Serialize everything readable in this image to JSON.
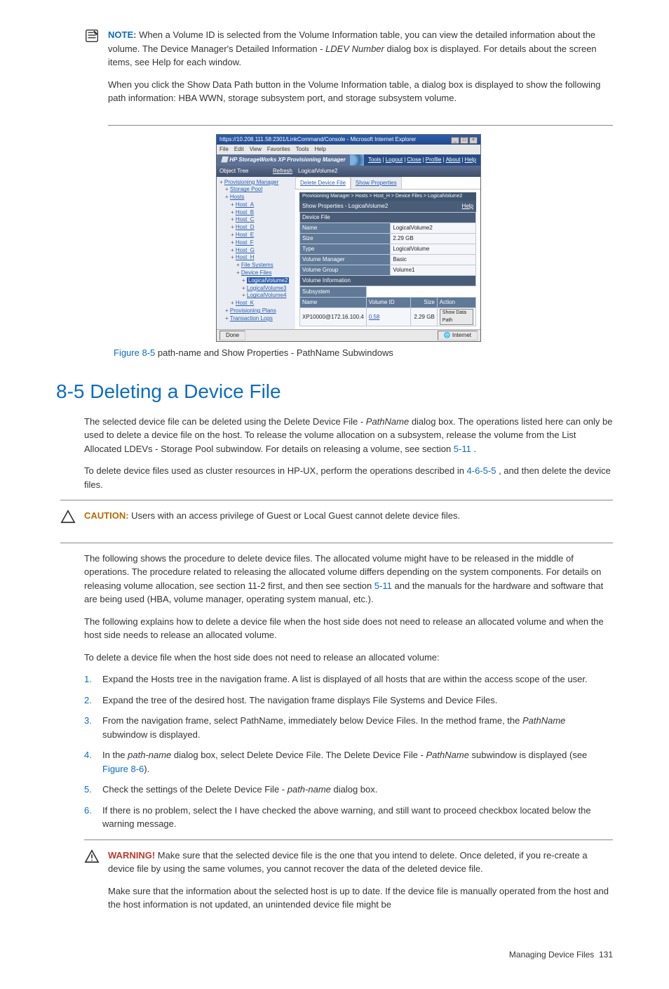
{
  "note": {
    "label": "NOTE:",
    "para1a": "When a Volume ID is selected from the Volume Information table, you can view the detailed information about the volume. The Device Manager's Detailed Information - ",
    "para1_italic": "LDEV Number",
    "para1b": " dialog box is displayed. For details about the screen items, see Help for each window.",
    "para2": "When you click the Show Data Path button in the Volume Information table, a dialog box is displayed to show the following path information: HBA WWN, storage subsystem port, and storage subsystem volume."
  },
  "figure": {
    "caption_link": "Figure 8-5",
    "caption_text": " path-name and Show Properties - PathName Subwindows",
    "shot": {
      "browser_title": "https://10.208.111.58:2301/LinkCommand/Console - Microsoft Internet Explorer",
      "menus": [
        "File",
        "Edit",
        "View",
        "Favorites",
        "Tools",
        "Help"
      ],
      "brand_box": "⬜",
      "brand": "HP StorageWorks XP Provisioning Manager",
      "brand_links": [
        "Tools",
        "Logout",
        "Close",
        "Profile",
        "About",
        "Help"
      ],
      "left_header": "Object Tree",
      "refresh": "Refresh",
      "tree": {
        "pm": "Provisioning Manager",
        "sp": "Storage Pool",
        "hosts": "Hosts",
        "hostA": "Host_A",
        "hostB": "Host_B",
        "hostC": "Host_C",
        "hostD": "Host_D",
        "hostE": "Host_E",
        "hostF": "Host_F",
        "hostG": "Host_G",
        "hostH": "Host_H",
        "fs": "File Systems",
        "df": "Device Files",
        "lv2": "LogicalVolume2",
        "lv3": "LogicalVolume3",
        "lv4": "LogicalVolume4",
        "hostK": "Host_K",
        "pp": "Provisioning Plans",
        "tl": "Transaction Logs"
      },
      "right_header": "LogicalVolume2",
      "method_nav": [
        "Delete Device File",
        "Show Properties"
      ],
      "crumb": "Provisioning Manager > Hosts > Host_H > Device Files > LogicalVolume2",
      "subhead": "Show Properties - LogicalVolume2",
      "help": "Help",
      "sections": {
        "device_file": "Device File",
        "vol_info": "Volume Information"
      },
      "rows": {
        "name_k": "Name",
        "name_v": "LogicalVolume2",
        "size_k": "Size",
        "size_v": "2.29 GB",
        "type_k": "Type",
        "type_v": "LogicalVolume",
        "vm_k": "Volume Manager",
        "vm_v": "Basic",
        "vg_k": "Volume Group",
        "vg_v": "Volume1"
      },
      "vol_cols": {
        "sub": "Subsystem",
        "name": "Name",
        "vid": "Volume ID",
        "size": "Size",
        "action": "Action"
      },
      "vol_row": {
        "sub": "XP10000@172.16.100.4",
        "vid": "0.58",
        "size": "2.29 GB",
        "btn": "Show Data Path"
      },
      "status_done": "Done",
      "status_net": "Internet"
    }
  },
  "section": {
    "title": "8-5 Deleting a Device File",
    "p1a": "The selected device file can be deleted using the Delete Device File - ",
    "p1_i": "PathName",
    "p1b": " dialog box. The operations listed here can only be used to delete a device file on the host. To release the volume allocation on a subsystem, release the volume from the List Allocated LDEVs - Storage Pool subwindow. For details on releasing a volume, see section ",
    "p1_link": "5-11",
    "p1c": " .",
    "p2a": "To delete device files used as cluster resources in HP-UX, perform the operations described in ",
    "p2_link": "4-6-5-5",
    "p2b": " , and then delete the device files."
  },
  "caution": {
    "label": "CAUTION:",
    "text": "Users with an access privilege of Guest or Local Guest cannot delete device files."
  },
  "body2": {
    "p1a": "The following shows the procedure to delete device files. The allocated volume might have to be released in the middle of operations. The procedure related to releasing the allocated volume differs depending on the system components. For details on releasing volume allocation, see section 11-2  first, and then see section ",
    "p1_link": "5-11",
    "p1b": "  and the manuals for the hardware and software that are being used (HBA, volume manager, operating system manual, etc.).",
    "p2": "The following explains how to delete a device file when the host side does not need to release an allocated volume and when the host side needs to release an allocated volume.",
    "p3": "To delete a device file when the host side does not need to release an allocated volume:"
  },
  "steps": {
    "s1": "Expand the Hosts tree in the navigation frame. A list is displayed of all hosts that are within the access scope of the user.",
    "s2": "Expand the tree of the desired host. The navigation frame displays File Systems and Device Files.",
    "s3a": "From the navigation frame, select PathName, immediately below Device Files. In the method frame, the ",
    "s3_i": "PathName",
    "s3b": " subwindow is displayed.",
    "s4a": "In the ",
    "s4_i1": "path-name",
    "s4b": " dialog box, select Delete Device File. The Delete Device File - ",
    "s4_i2": "PathName",
    "s4c": " subwindow is displayed (see ",
    "s4_link": "Figure 8-6",
    "s4d": ").",
    "s5a": "Check the settings of the Delete Device File - ",
    "s5_i": "path-name",
    "s5b": " dialog box.",
    "s6": "If there is no problem, select the I have checked the above warning, and still want to proceed checkbox located below the warning message."
  },
  "warning": {
    "label": "WARNING!",
    "p1": "Make sure that the selected device file is the one that you intend to delete. Once deleted, if you re-create a device file by using the same volumes, you cannot recover the data of the deleted device file.",
    "p2": "Make sure that the information about the selected host is up to date. If the device file is manually operated from the host and the host information is not updated, an unintended device file might be"
  },
  "footer": {
    "text": "Managing Device Files",
    "page": "131"
  }
}
